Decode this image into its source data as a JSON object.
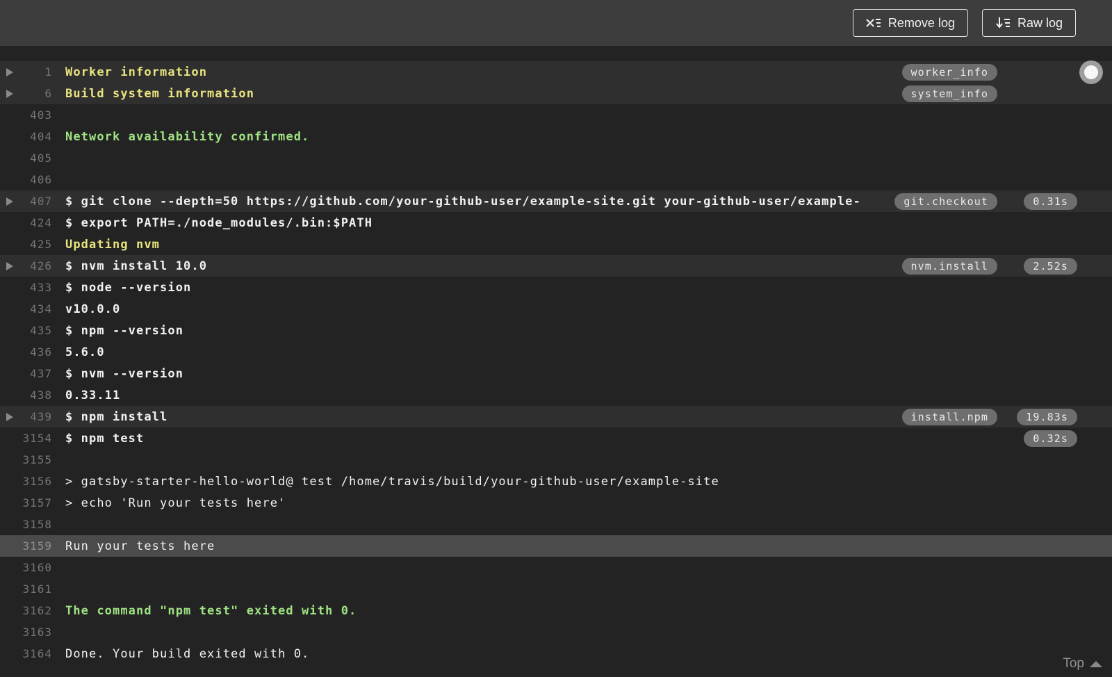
{
  "toolbar": {
    "remove_log_label": "Remove log",
    "raw_log_label": "Raw log"
  },
  "footer": {
    "top_label": "Top"
  },
  "colors": {
    "topbar_bg": "#3d3d3d",
    "log_bg": "#232323",
    "fold_row_bg": "#2f2f2f",
    "highlight_row_bg": "#4b4b4b",
    "yellow_text": "#eae47f",
    "green_text": "#9fe383",
    "badge_bg": "#6e6e6e"
  },
  "log": {
    "rows": [
      {
        "num": "1",
        "text": "Worker information",
        "style": "yellow",
        "arrow": true,
        "fold": true,
        "tag": "worker_info"
      },
      {
        "num": "6",
        "text": "Build system information",
        "style": "yellow",
        "arrow": true,
        "fold": true,
        "tag": "system_info"
      },
      {
        "num": "403",
        "text": ""
      },
      {
        "num": "404",
        "text": "Network availability confirmed.",
        "style": "green"
      },
      {
        "num": "405",
        "text": ""
      },
      {
        "num": "406",
        "text": ""
      },
      {
        "num": "407",
        "text": "$ git clone --depth=50 https://github.com/your-github-user/example-site.git your-github-user/example-",
        "style": "cmd",
        "arrow": true,
        "fold": true,
        "tag": "git.checkout",
        "time": "0.31s"
      },
      {
        "num": "424",
        "text": "$ export PATH=./node_modules/.bin:$PATH",
        "style": "cmd"
      },
      {
        "num": "425",
        "text": "Updating nvm",
        "style": "yellow"
      },
      {
        "num": "426",
        "text": "$ nvm install 10.0",
        "style": "cmd",
        "arrow": true,
        "fold": true,
        "tag": "nvm.install",
        "time": "2.52s"
      },
      {
        "num": "433",
        "text": "$ node --version",
        "style": "cmd"
      },
      {
        "num": "434",
        "text": "v10.0.0",
        "style": "cmd"
      },
      {
        "num": "435",
        "text": "$ npm --version",
        "style": "cmd"
      },
      {
        "num": "436",
        "text": "5.6.0",
        "style": "cmd"
      },
      {
        "num": "437",
        "text": "$ nvm --version",
        "style": "cmd"
      },
      {
        "num": "438",
        "text": "0.33.11",
        "style": "cmd"
      },
      {
        "num": "439",
        "text": "$ npm install",
        "style": "cmd",
        "arrow": true,
        "fold": true,
        "tag": "install.npm",
        "time": "19.83s"
      },
      {
        "num": "3154",
        "text": "$ npm test",
        "style": "cmd",
        "time": "0.32s"
      },
      {
        "num": "3155",
        "text": ""
      },
      {
        "num": "3156",
        "text": "> gatsby-starter-hello-world@ test /home/travis/build/your-github-user/example-site"
      },
      {
        "num": "3157",
        "text": "> echo 'Run your tests here'"
      },
      {
        "num": "3158",
        "text": ""
      },
      {
        "num": "3159",
        "text": "Run your tests here",
        "highlight": true
      },
      {
        "num": "3160",
        "text": ""
      },
      {
        "num": "3161",
        "text": ""
      },
      {
        "num": "3162",
        "text": "The command \"npm test\" exited with 0.",
        "style": "green"
      },
      {
        "num": "3163",
        "text": ""
      },
      {
        "num": "3164",
        "text": "Done. Your build exited with 0."
      }
    ]
  }
}
